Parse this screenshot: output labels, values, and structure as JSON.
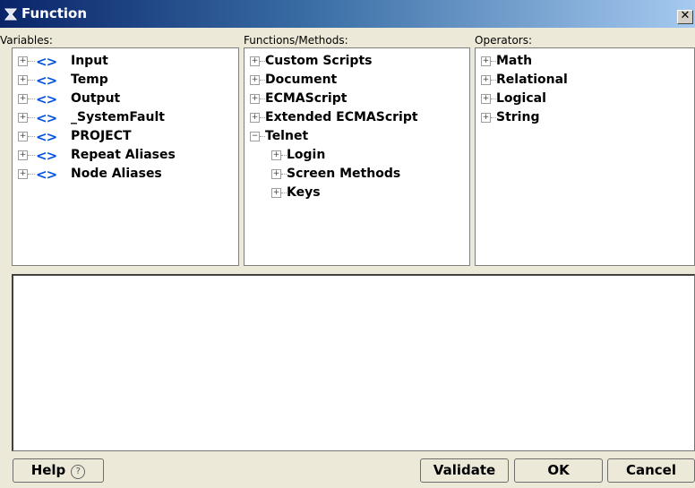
{
  "window": {
    "title": "Function",
    "close_glyph": "✕"
  },
  "panels": {
    "variables": {
      "label": "Variables:",
      "items": [
        {
          "label": "Input",
          "expanded": false
        },
        {
          "label": "Temp",
          "expanded": false
        },
        {
          "label": "Output",
          "expanded": false
        },
        {
          "label": "_SystemFault",
          "expanded": false
        },
        {
          "label": "PROJECT",
          "expanded": false
        },
        {
          "label": "Repeat Aliases",
          "expanded": false
        },
        {
          "label": "Node Aliases",
          "expanded": false
        }
      ],
      "icon_text": "<>"
    },
    "functions": {
      "label": "Functions/Methods:",
      "items": [
        {
          "label": "Custom Scripts",
          "expanded": false
        },
        {
          "label": "Document",
          "expanded": false
        },
        {
          "label": "ECMAScript",
          "expanded": false
        },
        {
          "label": "Extended ECMAScript",
          "expanded": false
        },
        {
          "label": "Telnet",
          "expanded": true,
          "children": [
            {
              "label": "Login",
              "expanded": false
            },
            {
              "label": "Screen Methods",
              "expanded": false
            },
            {
              "label": "Keys",
              "expanded": false
            }
          ]
        }
      ]
    },
    "operators": {
      "label": "Operators:",
      "items": [
        {
          "label": "Math",
          "expanded": false
        },
        {
          "label": "Relational",
          "expanded": false
        },
        {
          "label": "Logical",
          "expanded": false
        },
        {
          "label": "String",
          "expanded": false
        }
      ]
    }
  },
  "editor": {
    "value": ""
  },
  "buttons": {
    "help": "Help",
    "help_glyph": "?",
    "validate": "Validate",
    "ok": "OK",
    "cancel": "Cancel"
  },
  "colors": {
    "variable_icon": "#0050e0",
    "title_start": "#0a246a",
    "title_end": "#a6caf0"
  }
}
